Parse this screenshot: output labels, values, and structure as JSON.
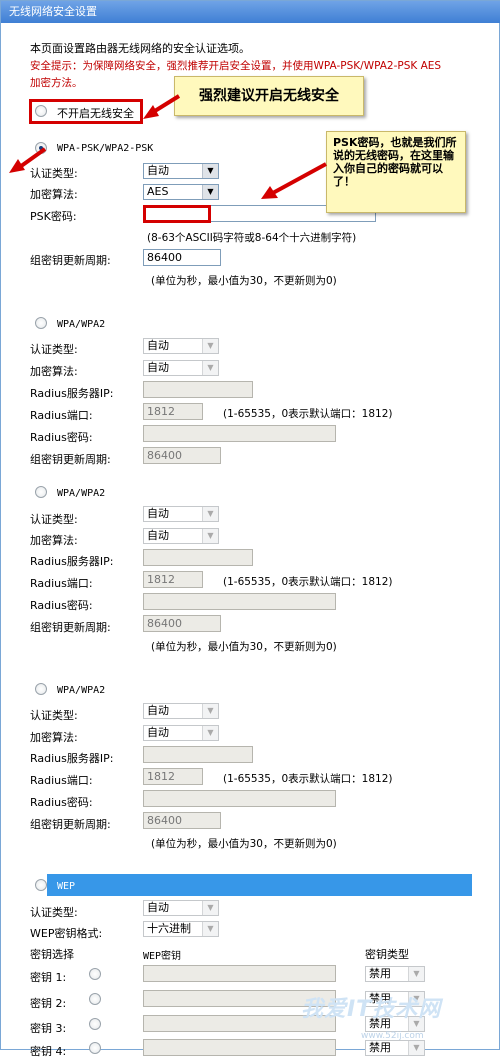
{
  "window": {
    "title": "无线网络安全设置"
  },
  "intro": {
    "text": "本页面设置路由器无线网络的安全认证选项。",
    "warning_line1": "安全提示：为保障网络安全，强烈推荐开启安全设置，并使用WPA-PSK/WPA2-PSK AES",
    "warning_line2": "加密方法。"
  },
  "disable_option": {
    "label": "不开启无线安全"
  },
  "callout_disable": {
    "text": "强烈建议开启无线安全"
  },
  "callout_psk": {
    "text": "PSK密码，也就是我们所说的无线密码，在这里输入你自己的密码就可以了！"
  },
  "wpa_psk": {
    "title": "WPA-PSK/WPA2-PSK",
    "auth_label": "认证类型:",
    "auth_value": "自动",
    "enc_label": "加密算法:",
    "enc_value": "AES",
    "psk_label": "PSK密码:",
    "psk_value": "",
    "psk_hint": "(8-63个ASCII码字符或8-64个十六进制字符)",
    "period_label": "组密钥更新周期:",
    "period_value": "86400",
    "period_hint": "(单位为秒，最小值为30，不更新则为0)"
  },
  "wpa_sections": [
    {
      "title": "WPA/WPA2",
      "auth_label": "认证类型:",
      "auth_value": "自动",
      "enc_label": "加密算法:",
      "enc_value": "自动",
      "ip_label": "Radius服务器IP:",
      "port_label": "Radius端口:",
      "port_value": "1812",
      "port_hint": "(1-65535，0表示默认端口：1812)",
      "pwd_label": "Radius密码:",
      "period_label": "组密钥更新周期:",
      "period_value": "86400",
      "period_hint": ""
    },
    {
      "title": "WPA/WPA2",
      "auth_label": "认证类型:",
      "auth_value": "自动",
      "enc_label": "加密算法:",
      "enc_value": "自动",
      "ip_label": "Radius服务器IP:",
      "port_label": "Radius端口:",
      "port_value": "1812",
      "port_hint": "(1-65535，0表示默认端口：1812)",
      "pwd_label": "Radius密码:",
      "period_label": "组密钥更新周期:",
      "period_value": "86400",
      "period_hint": "(单位为秒，最小值为30，不更新则为0)"
    },
    {
      "title": "WPA/WPA2",
      "auth_label": "认证类型:",
      "auth_value": "自动",
      "enc_label": "加密算法:",
      "enc_value": "自动",
      "ip_label": "Radius服务器IP:",
      "port_label": "Radius端口:",
      "port_value": "1812",
      "port_hint": "(1-65535，0表示默认端口：1812)",
      "pwd_label": "Radius密码:",
      "period_label": "组密钥更新周期:",
      "period_value": "86400",
      "period_hint": "(单位为秒，最小值为30，不更新则为0)"
    }
  ],
  "wep": {
    "title": "WEP",
    "auth_label": "认证类型:",
    "auth_value": "自动",
    "format_label": "WEP密钥格式:",
    "format_value": "十六进制",
    "col_select": "密钥选择",
    "col_key": "WEP密钥",
    "col_type": "密钥类型",
    "keys": [
      {
        "label": "密钥 1:",
        "type": "禁用"
      },
      {
        "label": "密钥 2:",
        "type": "禁用"
      },
      {
        "label": "密钥 3:",
        "type": "禁用"
      },
      {
        "label": "密钥 4:",
        "type": "禁用"
      }
    ]
  },
  "watermark": {
    "text": "我爱IT技术网",
    "sub": "www.52ij.com"
  },
  "colors": {
    "title_bar": "#3f7fd4",
    "warning": "#c00000",
    "highlight": "#d40000",
    "callout_bg": "#fff9bd",
    "wep_bar": "#3797e8"
  }
}
